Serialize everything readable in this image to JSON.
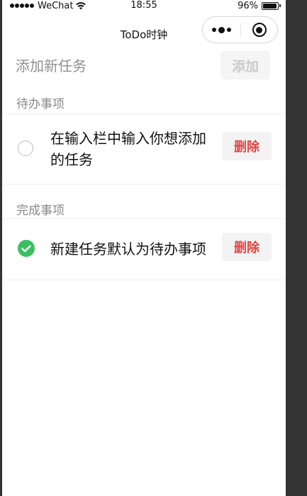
{
  "status_bar": {
    "carrier": "WeChat",
    "time": "18:55",
    "battery": "96%",
    "battery_level": 0.96
  },
  "nav": {
    "title": "ToDo时钟"
  },
  "add": {
    "placeholder": "添加新任务",
    "button_label": "添加"
  },
  "pending": {
    "title": "待办事项",
    "items": [
      {
        "text": "在输入栏中输入你想添加的任务",
        "delete_label": "删除",
        "done": false
      }
    ]
  },
  "completed": {
    "title": "完成事项",
    "items": [
      {
        "text": "新建任务默认为待办事项",
        "delete_label": "删除",
        "done": true
      }
    ]
  },
  "colors": {
    "accent_green": "#3bbf62",
    "delete_red": "#e64340"
  }
}
